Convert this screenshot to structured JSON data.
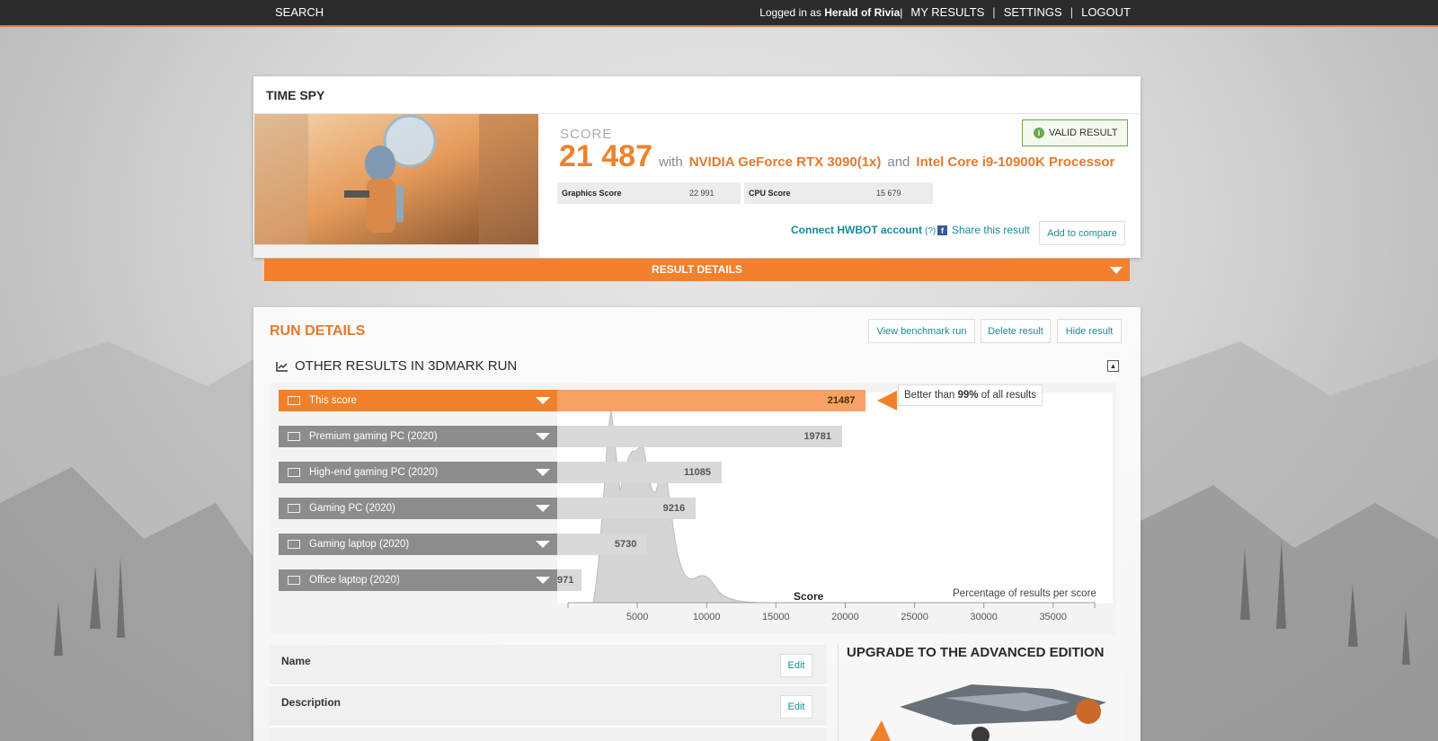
{
  "topbar": {
    "search": "SEARCH",
    "logged_in_prefix": "Logged in as",
    "username": "Herald of Rivia",
    "logged_sep": "|",
    "my_results": "MY RESULTS",
    "settings": "SETTINGS",
    "logout": "LOGOUT",
    "sep": "|"
  },
  "card": {
    "title": "TIME SPY",
    "score_label": "SCORE",
    "score_value": "21 487",
    "with": "with",
    "gpu": "NVIDIA GeForce RTX 3090(1x)",
    "and": "and",
    "cpu": "Intel Core i9-10900K Processor",
    "valid": "VALID RESULT",
    "graphics_label": "Graphics Score",
    "graphics_value": "22 991",
    "cpu_label": "CPU Score",
    "cpu_value": "15 679",
    "hwbot": "Connect HWBOT account",
    "hwbot_q": "(?)",
    "share": "Share this result",
    "add_compare": "Add to compare",
    "result_details": "RESULT DETAILS"
  },
  "run": {
    "title": "RUN DETAILS",
    "view_run": "View benchmark run",
    "delete": "Delete result",
    "hide": "Hide result",
    "other_title": "OTHER RESULTS IN 3DMARK RUN"
  },
  "comparison": {
    "better_prefix": "Better than",
    "better_pct": "99%",
    "better_suffix": "of all results",
    "rows": [
      {
        "label": "This score",
        "value": "21487"
      },
      {
        "label": "Premium gaming PC (2020)",
        "value": "19781"
      },
      {
        "label": "High-end gaming PC (2020)",
        "value": "11085"
      },
      {
        "label": "Gaming PC (2020)",
        "value": "9216"
      },
      {
        "label": "Gaming laptop (2020)",
        "value": "5730"
      },
      {
        "label": "Office laptop (2020)",
        "value": "971"
      }
    ],
    "axis_name": "Score",
    "pct_label": "Percentage of results per score",
    "ticks": [
      "5000",
      "10000",
      "15000",
      "20000",
      "25000",
      "30000",
      "35000"
    ]
  },
  "chart_data": {
    "type": "bar",
    "categories": [
      "This score",
      "Premium gaming PC (2020)",
      "High-end gaming PC (2020)",
      "Gaming PC (2020)",
      "Gaming laptop (2020)",
      "Office laptop (2020)"
    ],
    "values": [
      21487,
      19781,
      11085,
      9216,
      5730,
      971
    ],
    "xlabel": "Score",
    "ylabel": "Percentage of results per score",
    "xlim": [
      0,
      38000
    ],
    "xticks": [
      5000,
      10000,
      15000,
      20000,
      25000,
      30000,
      35000
    ]
  },
  "details": {
    "fields": [
      {
        "label": "Name",
        "edit": "Edit"
      },
      {
        "label": "Description",
        "edit": "Edit"
      }
    ],
    "upgrade_title": "UPGRADE TO THE ADVANCED EDITION"
  },
  "colors": {
    "accent": "#f0812a",
    "link": "#1a8a9a",
    "valid": "#6aa84f",
    "row_gray": "#8c8c8c"
  }
}
